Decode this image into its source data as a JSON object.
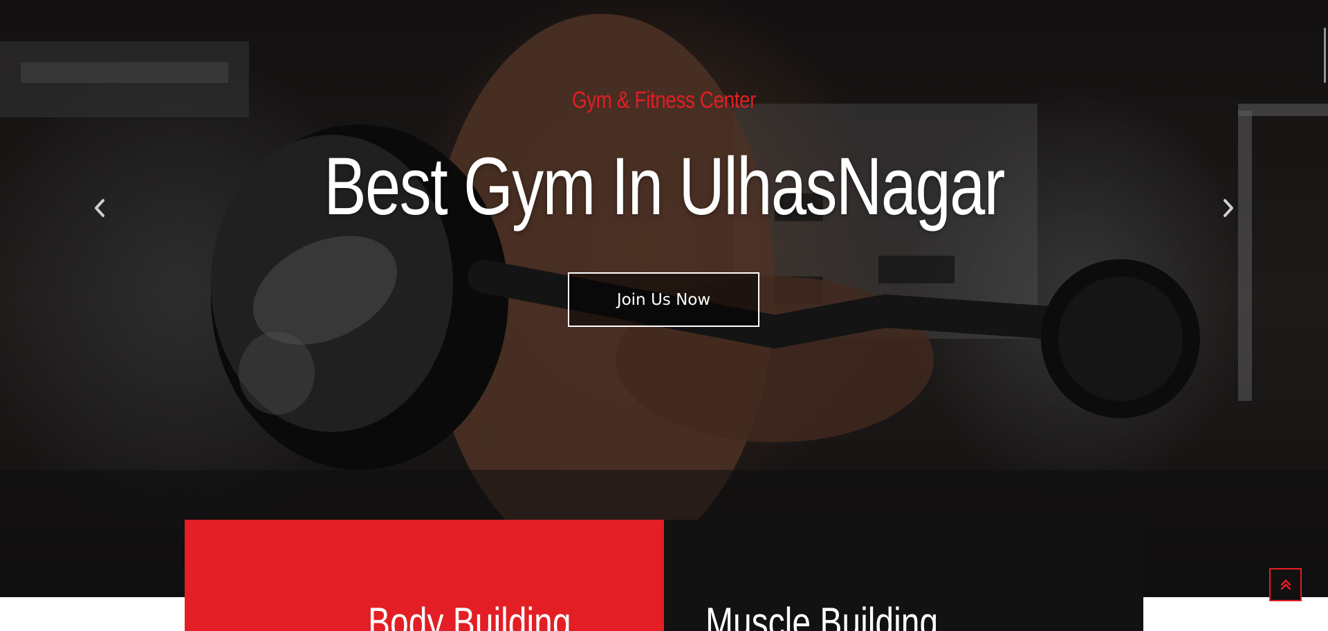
{
  "hero": {
    "subtitle": "Gym & Fitness Center",
    "title": "Best Gym In UlhasNagar",
    "cta_label": "Join Us Now",
    "prev_icon": "chevron-left-icon",
    "next_icon": "chevron-right-icon"
  },
  "services": [
    {
      "title": "Body Building",
      "bg": "#e31e24"
    },
    {
      "title": "Muscle Building",
      "bg": "#121212"
    }
  ],
  "scroll_top": {
    "icon": "double-chevron-up-icon"
  },
  "colors": {
    "accent": "#e31e24",
    "dark": "#121212",
    "text_light": "#ffffff"
  }
}
